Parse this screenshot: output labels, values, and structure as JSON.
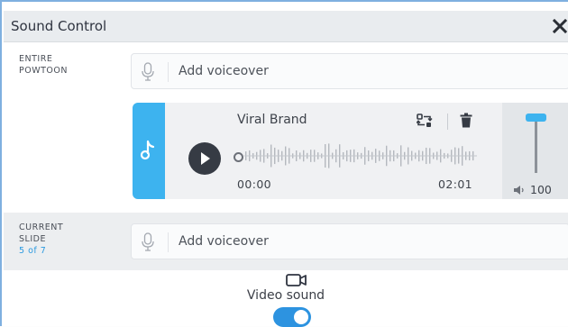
{
  "dialog": {
    "title": "Sound Control"
  },
  "entire_powtoon": {
    "label_line1": "ENTIRE",
    "label_line2": "POWTOON",
    "voiceover_label": "Add voiceover"
  },
  "track": {
    "name": "Viral Brand",
    "current_time": "00:00",
    "duration": "02:01",
    "volume": "100",
    "volume_level": 1.0,
    "accent_color": "#3db3ef"
  },
  "current_slide": {
    "label_line1": "CURRENT",
    "label_line2": "SLIDE",
    "slide_count": "5 of 7",
    "voiceover_label": "Add voiceover"
  },
  "video_sound": {
    "label": "Video sound",
    "enabled": true,
    "toggle_color": "#2d93e0"
  },
  "icons": {
    "close": "close-icon",
    "mic": "microphone-icon",
    "music": "music-note-icon",
    "swap": "swap-track-icon",
    "trash": "trash-icon",
    "play": "play-icon",
    "volume": "speaker-icon",
    "video": "video-camera-icon"
  }
}
